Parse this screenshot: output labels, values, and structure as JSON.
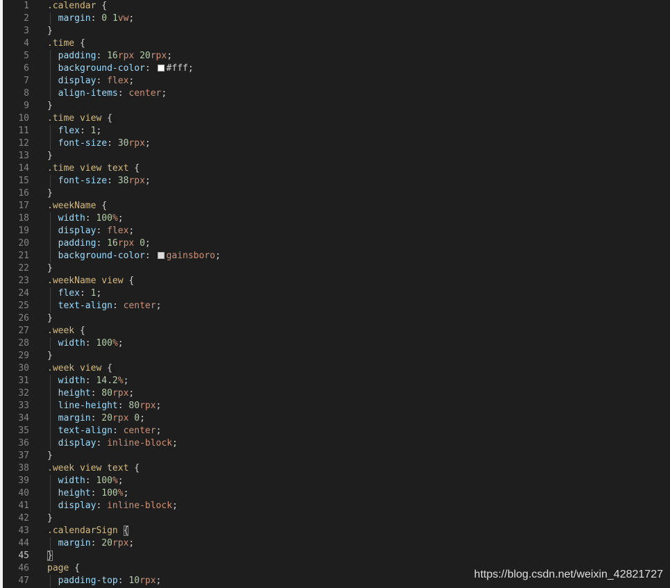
{
  "editor": {
    "theme": "dark",
    "active_line": 45,
    "colors": {
      "background": "#1e1e1e",
      "selector": "#d7ba7d",
      "property": "#9cdcfe",
      "number": "#b5cea8",
      "unit": "#ce9178",
      "keyword": "#ce9178",
      "punctuation": "#d4d4d4",
      "line_number": "#858585"
    },
    "lines": [
      {
        "n": "1",
        "tokens": [
          [
            "sel",
            ".calendar"
          ],
          [
            "punc",
            " {"
          ]
        ]
      },
      {
        "n": "2",
        "indent": true,
        "tokens": [
          [
            "prop",
            "margin"
          ],
          [
            "punc",
            ": "
          ],
          [
            "num",
            "0"
          ],
          [
            "punc",
            " "
          ],
          [
            "num",
            "1"
          ],
          [
            "unit",
            "vw"
          ],
          [
            "punc",
            ";"
          ]
        ]
      },
      {
        "n": "3",
        "tokens": [
          [
            "punc",
            "}"
          ]
        ]
      },
      {
        "n": "4",
        "tokens": [
          [
            "sel",
            ".time"
          ],
          [
            "punc",
            " {"
          ]
        ]
      },
      {
        "n": "5",
        "indent": true,
        "tokens": [
          [
            "prop",
            "padding"
          ],
          [
            "punc",
            ": "
          ],
          [
            "num",
            "16"
          ],
          [
            "unit",
            "rpx"
          ],
          [
            "punc",
            " "
          ],
          [
            "num",
            "20"
          ],
          [
            "unit",
            "rpx"
          ],
          [
            "punc",
            ";"
          ]
        ]
      },
      {
        "n": "6",
        "indent": true,
        "tokens": [
          [
            "prop",
            "background-color"
          ],
          [
            "punc",
            ": "
          ],
          [
            "swatch",
            "#ffffff"
          ],
          [
            "plain",
            "#fff"
          ],
          [
            "punc",
            ";"
          ]
        ]
      },
      {
        "n": "7",
        "indent": true,
        "tokens": [
          [
            "prop",
            "display"
          ],
          [
            "punc",
            ": "
          ],
          [
            "kw",
            "flex"
          ],
          [
            "punc",
            ";"
          ]
        ]
      },
      {
        "n": "8",
        "indent": true,
        "tokens": [
          [
            "prop",
            "align-items"
          ],
          [
            "punc",
            ": "
          ],
          [
            "kw",
            "center"
          ],
          [
            "punc",
            ";"
          ]
        ]
      },
      {
        "n": "9",
        "tokens": [
          [
            "punc",
            "}"
          ]
        ]
      },
      {
        "n": "10",
        "tokens": [
          [
            "sel",
            ".time"
          ],
          [
            "punc",
            " "
          ],
          [
            "tag",
            "view"
          ],
          [
            "punc",
            " {"
          ]
        ]
      },
      {
        "n": "11",
        "indent": true,
        "tokens": [
          [
            "prop",
            "flex"
          ],
          [
            "punc",
            ": "
          ],
          [
            "num",
            "1"
          ],
          [
            "punc",
            ";"
          ]
        ]
      },
      {
        "n": "12",
        "indent": true,
        "tokens": [
          [
            "prop",
            "font-size"
          ],
          [
            "punc",
            ": "
          ],
          [
            "num",
            "30"
          ],
          [
            "unit",
            "rpx"
          ],
          [
            "punc",
            ";"
          ]
        ]
      },
      {
        "n": "13",
        "tokens": [
          [
            "punc",
            "}"
          ]
        ]
      },
      {
        "n": "14",
        "tokens": [
          [
            "sel",
            ".time"
          ],
          [
            "punc",
            " "
          ],
          [
            "tag",
            "view"
          ],
          [
            "punc",
            " "
          ],
          [
            "tag",
            "text"
          ],
          [
            "punc",
            " {"
          ]
        ]
      },
      {
        "n": "15",
        "indent": true,
        "tokens": [
          [
            "prop",
            "font-size"
          ],
          [
            "punc",
            ": "
          ],
          [
            "num",
            "38"
          ],
          [
            "unit",
            "rpx"
          ],
          [
            "punc",
            ";"
          ]
        ]
      },
      {
        "n": "16",
        "tokens": [
          [
            "punc",
            "}"
          ]
        ]
      },
      {
        "n": "17",
        "tokens": [
          [
            "sel",
            ".weekName"
          ],
          [
            "punc",
            " {"
          ]
        ]
      },
      {
        "n": "18",
        "indent": true,
        "tokens": [
          [
            "prop",
            "width"
          ],
          [
            "punc",
            ": "
          ],
          [
            "num",
            "100"
          ],
          [
            "unit",
            "%"
          ],
          [
            "punc",
            ";"
          ]
        ]
      },
      {
        "n": "19",
        "indent": true,
        "tokens": [
          [
            "prop",
            "display"
          ],
          [
            "punc",
            ": "
          ],
          [
            "kw",
            "flex"
          ],
          [
            "punc",
            ";"
          ]
        ]
      },
      {
        "n": "20",
        "indent": true,
        "tokens": [
          [
            "prop",
            "padding"
          ],
          [
            "punc",
            ": "
          ],
          [
            "num",
            "16"
          ],
          [
            "unit",
            "rpx"
          ],
          [
            "punc",
            " "
          ],
          [
            "num",
            "0"
          ],
          [
            "punc",
            ";"
          ]
        ]
      },
      {
        "n": "21",
        "indent": true,
        "tokens": [
          [
            "prop",
            "background-color"
          ],
          [
            "punc",
            ": "
          ],
          [
            "swatch",
            "#dcdcdc"
          ],
          [
            "kw",
            "gainsboro"
          ],
          [
            "punc",
            ";"
          ]
        ]
      },
      {
        "n": "22",
        "tokens": [
          [
            "punc",
            "}"
          ]
        ]
      },
      {
        "n": "23",
        "tokens": [
          [
            "sel",
            ".weekName"
          ],
          [
            "punc",
            " "
          ],
          [
            "tag",
            "view"
          ],
          [
            "punc",
            " {"
          ]
        ]
      },
      {
        "n": "24",
        "indent": true,
        "tokens": [
          [
            "prop",
            "flex"
          ],
          [
            "punc",
            ": "
          ],
          [
            "num",
            "1"
          ],
          [
            "punc",
            ";"
          ]
        ]
      },
      {
        "n": "25",
        "indent": true,
        "tokens": [
          [
            "prop",
            "text-align"
          ],
          [
            "punc",
            ": "
          ],
          [
            "kw",
            "center"
          ],
          [
            "punc",
            ";"
          ]
        ]
      },
      {
        "n": "26",
        "tokens": [
          [
            "punc",
            "}"
          ]
        ]
      },
      {
        "n": "27",
        "tokens": [
          [
            "sel",
            ".week"
          ],
          [
            "punc",
            " {"
          ]
        ]
      },
      {
        "n": "28",
        "indent": true,
        "tokens": [
          [
            "prop",
            "width"
          ],
          [
            "punc",
            ": "
          ],
          [
            "num",
            "100"
          ],
          [
            "unit",
            "%"
          ],
          [
            "punc",
            ";"
          ]
        ]
      },
      {
        "n": "29",
        "tokens": [
          [
            "punc",
            "}"
          ]
        ]
      },
      {
        "n": "30",
        "tokens": [
          [
            "sel",
            ".week"
          ],
          [
            "punc",
            " "
          ],
          [
            "tag",
            "view"
          ],
          [
            "punc",
            " {"
          ]
        ]
      },
      {
        "n": "31",
        "indent": true,
        "tokens": [
          [
            "prop",
            "width"
          ],
          [
            "punc",
            ": "
          ],
          [
            "num",
            "14.2"
          ],
          [
            "unit",
            "%"
          ],
          [
            "punc",
            ";"
          ]
        ]
      },
      {
        "n": "32",
        "indent": true,
        "tokens": [
          [
            "prop",
            "height"
          ],
          [
            "punc",
            ": "
          ],
          [
            "num",
            "80"
          ],
          [
            "unit",
            "rpx"
          ],
          [
            "punc",
            ";"
          ]
        ]
      },
      {
        "n": "33",
        "indent": true,
        "tokens": [
          [
            "prop",
            "line-height"
          ],
          [
            "punc",
            ": "
          ],
          [
            "num",
            "80"
          ],
          [
            "unit",
            "rpx"
          ],
          [
            "punc",
            ";"
          ]
        ]
      },
      {
        "n": "34",
        "indent": true,
        "tokens": [
          [
            "prop",
            "margin"
          ],
          [
            "punc",
            ": "
          ],
          [
            "num",
            "20"
          ],
          [
            "unit",
            "rpx"
          ],
          [
            "punc",
            " "
          ],
          [
            "num",
            "0"
          ],
          [
            "punc",
            ";"
          ]
        ]
      },
      {
        "n": "35",
        "indent": true,
        "tokens": [
          [
            "prop",
            "text-align"
          ],
          [
            "punc",
            ": "
          ],
          [
            "kw",
            "center"
          ],
          [
            "punc",
            ";"
          ]
        ]
      },
      {
        "n": "36",
        "indent": true,
        "tokens": [
          [
            "prop",
            "display"
          ],
          [
            "punc",
            ": "
          ],
          [
            "kw",
            "inline-block"
          ],
          [
            "punc",
            ";"
          ]
        ]
      },
      {
        "n": "37",
        "tokens": [
          [
            "punc",
            "}"
          ]
        ]
      },
      {
        "n": "38",
        "tokens": [
          [
            "sel",
            ".week"
          ],
          [
            "punc",
            " "
          ],
          [
            "tag",
            "view"
          ],
          [
            "punc",
            " "
          ],
          [
            "tag",
            "text"
          ],
          [
            "punc",
            " {"
          ]
        ]
      },
      {
        "n": "39",
        "indent": true,
        "tokens": [
          [
            "prop",
            "width"
          ],
          [
            "punc",
            ": "
          ],
          [
            "num",
            "100"
          ],
          [
            "unit",
            "%"
          ],
          [
            "punc",
            ";"
          ]
        ]
      },
      {
        "n": "40",
        "indent": true,
        "tokens": [
          [
            "prop",
            "height"
          ],
          [
            "punc",
            ": "
          ],
          [
            "num",
            "100"
          ],
          [
            "unit",
            "%"
          ],
          [
            "punc",
            ";"
          ]
        ]
      },
      {
        "n": "41",
        "indent": true,
        "tokens": [
          [
            "prop",
            "display"
          ],
          [
            "punc",
            ": "
          ],
          [
            "kw",
            "inline-block"
          ],
          [
            "punc",
            ";"
          ]
        ]
      },
      {
        "n": "42",
        "tokens": [
          [
            "punc",
            "}"
          ]
        ]
      },
      {
        "n": "43",
        "tokens": [
          [
            "sel",
            ".calendarSign"
          ],
          [
            "punc",
            " "
          ],
          [
            "bracket",
            "{"
          ]
        ]
      },
      {
        "n": "44",
        "indent": true,
        "tokens": [
          [
            "prop",
            "margin"
          ],
          [
            "punc",
            ": "
          ],
          [
            "num",
            "20"
          ],
          [
            "unit",
            "rpx"
          ],
          [
            "punc",
            ";"
          ]
        ]
      },
      {
        "n": "45",
        "tokens": [
          [
            "bracket",
            "}"
          ]
        ]
      },
      {
        "n": "46",
        "tokens": [
          [
            "tag",
            "page"
          ],
          [
            "punc",
            " {"
          ]
        ]
      },
      {
        "n": "47",
        "indent": true,
        "tokens": [
          [
            "prop",
            "padding-top"
          ],
          [
            "punc",
            ": "
          ],
          [
            "num",
            "10"
          ],
          [
            "unit",
            "rpx"
          ],
          [
            "punc",
            ";"
          ]
        ]
      }
    ]
  },
  "watermark": "https://blog.csdn.net/weixin_42821727"
}
